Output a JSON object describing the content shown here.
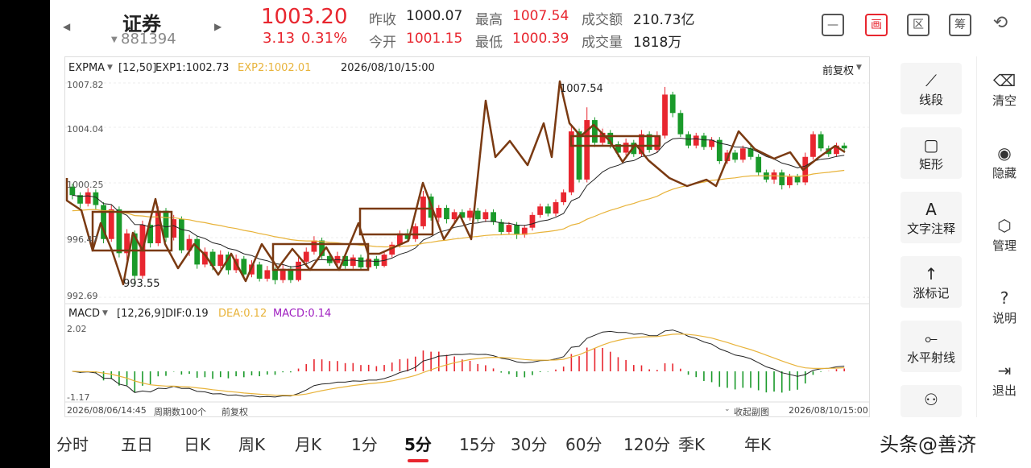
{
  "header": {
    "stock_name": "证券",
    "stock_code": "881394",
    "price": "1003.20",
    "change": "3.13",
    "change_pct": "0.31%",
    "prev_close_label": "昨收",
    "prev_close": "1000.07",
    "open_label": "今开",
    "open": "1001.15",
    "high_label": "最高",
    "high": "1007.54",
    "low_label": "最低",
    "low": "1000.39",
    "turnover_label": "成交额",
    "turnover": "210.73亿",
    "volume_label": "成交量",
    "volume": "1818万",
    "icons": [
      {
        "name": "minus-box-icon",
        "glyph": "—"
      },
      {
        "name": "draw-icon",
        "glyph": "画"
      },
      {
        "name": "range-icon",
        "glyph": "区"
      },
      {
        "name": "chips-icon",
        "glyph": "筹"
      },
      {
        "name": "rotate-screen-icon",
        "glyph": "⟲"
      }
    ]
  },
  "main_chart": {
    "indicator": "EXPMA",
    "params": "[12,50]",
    "exp1": "EXP1:1002.73",
    "exp2": "EXP2:1002.01",
    "datetime": "2026/08/10/15:00",
    "adjust": "前复权",
    "y_labels": [
      "1007.82",
      "1004.04",
      "1000.25",
      "996.47",
      "992.69"
    ],
    "high_mark": "1007.54",
    "low_mark": "993.55"
  },
  "macd_chart": {
    "indicator": "MACD",
    "params": "[12,26,9]",
    "dif": "DIF:0.19",
    "dea": "DEA:0.12",
    "macd": "MACD:0.14",
    "y_top": "2.02",
    "y_bottom": "-1.17"
  },
  "footer": {
    "start_time": "2026/08/06/14:45",
    "period_count": "周期数100个",
    "adjust": "前复权",
    "collapse": "收起副图",
    "end_time": "2026/08/10/15:00"
  },
  "tools": [
    {
      "label": "线段",
      "icon": "line-segment-icon",
      "glyph": "⟋"
    },
    {
      "label": "矩形",
      "icon": "rectangle-icon",
      "glyph": "▢"
    },
    {
      "label": "文字注释",
      "icon": "text-icon",
      "glyph": "A"
    },
    {
      "label": "涨标记",
      "icon": "up-arrow-icon",
      "glyph": "↑"
    },
    {
      "label": "水平射线",
      "icon": "ray-icon",
      "glyph": "⟜"
    }
  ],
  "side_actions": [
    {
      "label": "清空",
      "icon": "trash-icon",
      "glyph": "⌫"
    },
    {
      "label": "隐藏",
      "icon": "eye-icon",
      "glyph": "◉"
    },
    {
      "label": "管理",
      "icon": "manage-icon",
      "glyph": "⬡"
    },
    {
      "label": "说明",
      "icon": "help-icon",
      "glyph": "?"
    },
    {
      "label": "退出",
      "icon": "exit-icon",
      "glyph": "⇥"
    }
  ],
  "periods": [
    "分时",
    "五日",
    "日K",
    "周K",
    "月K",
    "1分",
    "5分",
    "15分",
    "30分",
    "60分",
    "120分",
    "季K",
    "年K"
  ],
  "active_period": "5分",
  "watermark": "头条@善济",
  "colors": {
    "up": "#e8262f",
    "down": "#1a9a2a",
    "exp1": "#222222",
    "exp2": "#e8b33a",
    "drawing": "#7a3a12",
    "dea": "#e8b33a",
    "macd": "#a020c0"
  },
  "chart_data": {
    "type": "candlestick",
    "ylim": [
      992.69,
      1007.82
    ],
    "candles": [
      [
        1000.5,
        999.9,
        1000.7,
        999.6
      ],
      [
        999.9,
        999.3,
        1000.1,
        999.0
      ],
      [
        999.3,
        1000.1,
        1000.4,
        999.1
      ],
      [
        1000.1,
        999.2,
        1000.3,
        998.9
      ],
      [
        999.2,
        996.8,
        999.4,
        996.5
      ],
      [
        996.8,
        998.9,
        999.2,
        996.6
      ],
      [
        998.9,
        995.8,
        999.1,
        995.5
      ],
      [
        995.8,
        997.2,
        997.5,
        995.3
      ],
      [
        997.2,
        994.2,
        997.4,
        993.55
      ],
      [
        994.2,
        997.8,
        998.1,
        994.0
      ],
      [
        997.8,
        996.5,
        998.2,
        996.2
      ],
      [
        996.5,
        998.8,
        999.1,
        996.3
      ],
      [
        998.8,
        996.9,
        999.0,
        996.6
      ],
      [
        996.9,
        998.2,
        998.5,
        996.7
      ],
      [
        998.2,
        996.0,
        998.4,
        995.8
      ],
      [
        996.0,
        996.8,
        997.1,
        995.6
      ],
      [
        996.8,
        995.0,
        997.0,
        994.7
      ],
      [
        995.0,
        995.9,
        996.2,
        994.8
      ],
      [
        995.9,
        994.9,
        996.1,
        994.6
      ],
      [
        994.9,
        995.7,
        996.0,
        994.7
      ],
      [
        995.7,
        994.6,
        995.9,
        994.3
      ],
      [
        994.6,
        995.4,
        995.7,
        994.4
      ],
      [
        995.4,
        994.3,
        995.6,
        994.1
      ],
      [
        994.3,
        995.0,
        995.3,
        994.1
      ],
      [
        995.0,
        994.0,
        995.2,
        993.8
      ],
      [
        994.0,
        994.6,
        994.9,
        993.8
      ],
      [
        994.6,
        993.9,
        994.8,
        993.6
      ],
      [
        993.9,
        994.7,
        995.0,
        993.7
      ],
      [
        994.7,
        993.9,
        994.9,
        993.7
      ],
      [
        993.9,
        995.2,
        995.5,
        993.8
      ],
      [
        995.2,
        995.9,
        996.2,
        995.0
      ],
      [
        995.9,
        996.7,
        997.0,
        995.7
      ],
      [
        996.7,
        995.6,
        996.9,
        995.4
      ],
      [
        995.6,
        995.1,
        995.8,
        994.9
      ],
      [
        995.1,
        995.6,
        995.9,
        994.9
      ],
      [
        995.6,
        994.9,
        995.8,
        994.7
      ],
      [
        994.9,
        995.5,
        995.7,
        994.7
      ],
      [
        995.5,
        994.8,
        995.7,
        994.6
      ],
      [
        994.8,
        995.4,
        995.6,
        994.6
      ],
      [
        995.4,
        994.9,
        995.6,
        994.7
      ],
      [
        994.9,
        995.7,
        995.9,
        994.8
      ],
      [
        995.7,
        996.4,
        996.6,
        995.5
      ],
      [
        996.4,
        997.2,
        997.4,
        996.2
      ],
      [
        997.2,
        996.8,
        997.5,
        996.6
      ],
      [
        996.8,
        997.7,
        997.9,
        996.6
      ],
      [
        997.7,
        999.8,
        1000.2,
        997.5
      ],
      [
        999.8,
        998.3,
        1000.0,
        998.1
      ],
      [
        998.3,
        999.0,
        999.2,
        998.0
      ],
      [
        999.0,
        998.2,
        999.2,
        997.9
      ],
      [
        998.2,
        998.7,
        998.9,
        998.0
      ],
      [
        998.7,
        998.3,
        998.9,
        998.0
      ],
      [
        998.3,
        998.8,
        999.0,
        998.1
      ],
      [
        998.8,
        998.2,
        999.0,
        998.0
      ],
      [
        998.2,
        998.7,
        998.9,
        998.0
      ],
      [
        998.7,
        998.0,
        998.9,
        997.8
      ],
      [
        998.0,
        997.3,
        998.2,
        997.1
      ],
      [
        997.3,
        997.8,
        998.0,
        997.1
      ],
      [
        997.8,
        997.1,
        998.0,
        996.8
      ],
      [
        997.1,
        997.6,
        997.8,
        996.9
      ],
      [
        997.6,
        998.5,
        998.7,
        997.4
      ],
      [
        998.5,
        999.1,
        999.3,
        998.3
      ],
      [
        999.1,
        998.6,
        999.3,
        998.4
      ],
      [
        998.6,
        999.4,
        999.6,
        998.4
      ],
      [
        999.4,
        1000.1,
        1000.3,
        999.2
      ],
      [
        1000.1,
        1004.4,
        1004.8,
        999.9
      ],
      [
        1004.4,
        1001.0,
        1004.6,
        1000.8
      ],
      [
        1001.0,
        1005.2,
        1006.1,
        1000.8
      ],
      [
        1005.2,
        1003.6,
        1005.4,
        1003.3
      ],
      [
        1003.6,
        1004.3,
        1004.6,
        1003.4
      ],
      [
        1004.3,
        1003.5,
        1004.5,
        1003.2
      ],
      [
        1003.5,
        1002.9,
        1003.7,
        1002.6
      ],
      [
        1002.9,
        1003.6,
        1003.9,
        1002.7
      ],
      [
        1003.6,
        1002.8,
        1003.8,
        1002.6
      ],
      [
        1002.8,
        1004.2,
        1004.5,
        1002.6
      ],
      [
        1004.2,
        1003.1,
        1004.4,
        1002.9
      ],
      [
        1003.1,
        1004.1,
        1004.4,
        1002.9
      ],
      [
        1004.1,
        1007.0,
        1007.54,
        1003.9
      ],
      [
        1007.0,
        1005.7,
        1007.2,
        1005.4
      ],
      [
        1005.7,
        1004.2,
        1005.9,
        1004.0
      ],
      [
        1004.2,
        1003.4,
        1004.4,
        1003.2
      ],
      [
        1003.4,
        1004.1,
        1004.3,
        1003.2
      ],
      [
        1004.1,
        1003.3,
        1004.3,
        1003.1
      ],
      [
        1003.3,
        1003.8,
        1004.0,
        1003.1
      ],
      [
        1003.8,
        1002.3,
        1004.0,
        1002.1
      ],
      [
        1002.3,
        1002.9,
        1003.1,
        1002.1
      ],
      [
        1002.9,
        1002.4,
        1003.1,
        1002.2
      ],
      [
        1002.4,
        1003.2,
        1003.4,
        1002.2
      ],
      [
        1003.2,
        1002.6,
        1003.4,
        1002.4
      ],
      [
        1002.6,
        1001.5,
        1002.8,
        1001.3
      ],
      [
        1001.5,
        1001.0,
        1001.7,
        1000.8
      ],
      [
        1001.0,
        1001.5,
        1001.7,
        1000.7
      ],
      [
        1001.5,
        1000.6,
        1001.7,
        1000.3
      ],
      [
        1000.6,
        1001.2,
        1001.4,
        1000.4
      ],
      [
        1001.2,
        1000.8,
        1001.4,
        1000.6
      ],
      [
        1000.8,
        1002.6,
        1002.9,
        1000.6
      ],
      [
        1002.6,
        1004.2,
        1004.4,
        1002.4
      ],
      [
        1004.2,
        1003.2,
        1004.4,
        1003.0
      ],
      [
        1003.2,
        1002.8,
        1003.4,
        1002.6
      ],
      [
        1002.8,
        1003.4,
        1003.6,
        1002.6
      ],
      [
        1003.4,
        1003.2,
        1003.6,
        1003.0
      ]
    ]
  }
}
